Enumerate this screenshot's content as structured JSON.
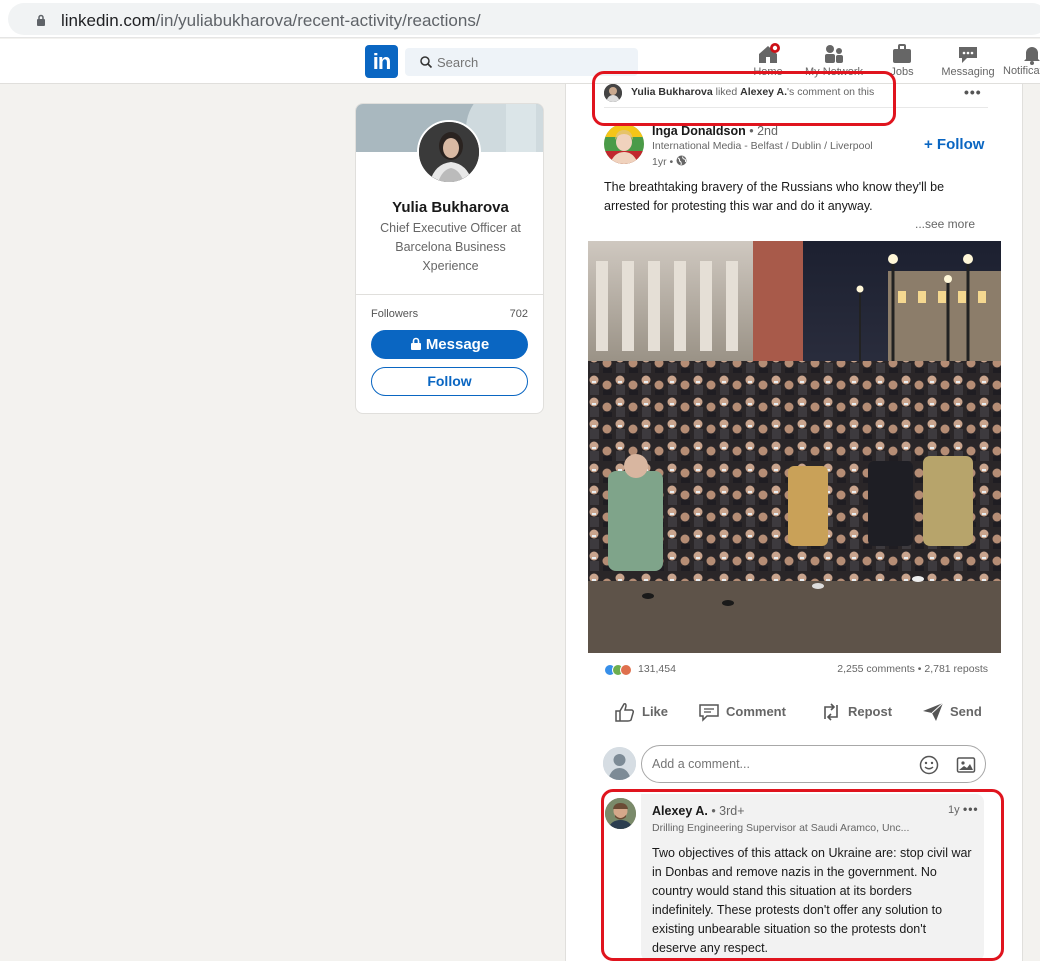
{
  "browser": {
    "url_host": "linkedin.com",
    "url_path": "/in/yuliabukharova/recent-activity/reactions/"
  },
  "nav": {
    "logo": "in",
    "search_placeholder": "Search",
    "items": [
      {
        "label": "Home",
        "icon": "home-icon"
      },
      {
        "label": "My Network",
        "icon": "network-icon"
      },
      {
        "label": "Jobs",
        "icon": "briefcase-icon"
      },
      {
        "label": "Messaging",
        "icon": "messaging-icon"
      },
      {
        "label": "Notifications",
        "icon": "bell-icon"
      }
    ]
  },
  "profile": {
    "name": "Yulia Bukharova",
    "title": "Chief Executive Officer at Barcelona Business Xperience",
    "followers_label": "Followers",
    "followers_count": "702",
    "message_label": "Message",
    "follow_label": "Follow"
  },
  "activity": {
    "actor": "Yulia Bukharova",
    "verb": "liked",
    "target": "Alexey A.",
    "suffix": "'s comment on this"
  },
  "post": {
    "author": "Inga Donaldson",
    "degree": "• 2nd",
    "headline": "International Media - Belfast / Dublin / Liverpool",
    "time": "1yr •",
    "follow_label": "+ Follow",
    "text": "The breathtaking bravery of the Russians who know they'll be arrested for protesting this war and do it anyway.",
    "see_more": "...see more",
    "reactions_count": "131,454",
    "comments_reposts": "2,255 comments • 2,781 reposts",
    "actions": {
      "like": "Like",
      "comment": "Comment",
      "repost": "Repost",
      "send": "Send"
    },
    "comment_placeholder": "Add a comment..."
  },
  "comment": {
    "author": "Alexey A.",
    "degree": "• 3rd+",
    "headline": "Drilling Engineering Supervisor at Saudi Aramco, Unc...",
    "time": "1y",
    "text": "Two objectives of this attack on Ukraine are: stop civil war in Donbas and remove nazis in the government. No country would stand this situation at its borders indefinitely. These protests don't offer any solution to existing unbearable situation so the protests don't deserve any respect."
  },
  "colors": {
    "brand": "#0a66c2",
    "highlight": "#e0141e",
    "page_bg": "#f3f2ef"
  }
}
